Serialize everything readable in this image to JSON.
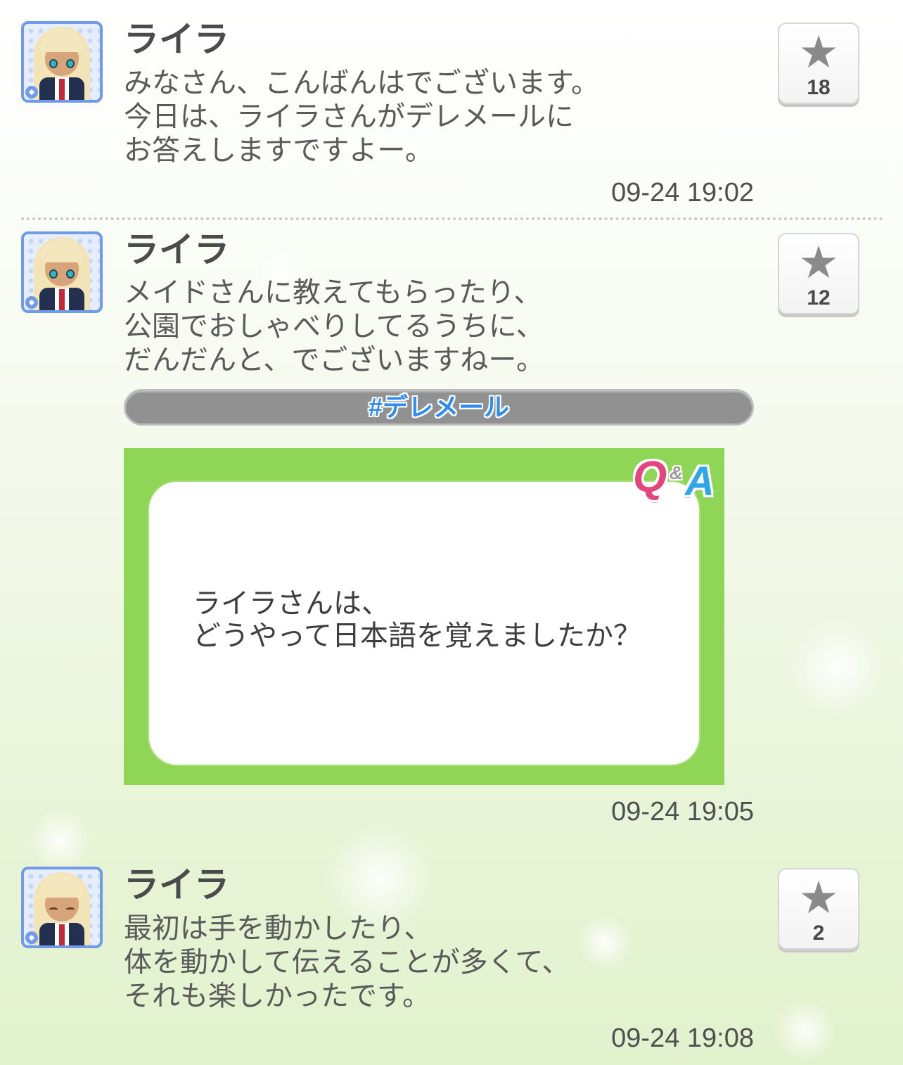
{
  "posts": [
    {
      "author": "ライラ",
      "message": "みなさん、こんばんはでございます。\n今日は、ライラさんがデレメールに\nお答えしますですよー。",
      "timestamp": "09-24 19:02",
      "likes": "18",
      "avatar_expression": "smile-open-eyes"
    },
    {
      "author": "ライラ",
      "message": "メイドさんに教えてもらったり、\n公園でおしゃべりしてるうちに、\nだんだんと、でございますねー。",
      "timestamp": "09-24 19:05",
      "likes": "12",
      "hashtag": "#デレメール",
      "qa_card": {
        "logo_q": "Q",
        "logo_amp": "&",
        "logo_a": "A",
        "question": "ライラさんは、\nどうやって日本語を覚えましたか？"
      },
      "avatar_expression": "neutral-open-eyes"
    },
    {
      "author": "ライラ",
      "message": "最初は手を動かしたり、\n体を動かして伝えることが多くて、\nそれも楽しかったです。",
      "timestamp": "09-24 19:08",
      "likes": "2",
      "avatar_expression": "closed-eyes-smile"
    }
  ],
  "icons": {
    "like": "star-icon",
    "badge": "diamond-icon"
  },
  "colors": {
    "avatar_border": "#6f9be8",
    "qa_card_green": "#8fd657",
    "hashtag_text": "#2f8df2",
    "hashtag_bg": "#919191"
  }
}
